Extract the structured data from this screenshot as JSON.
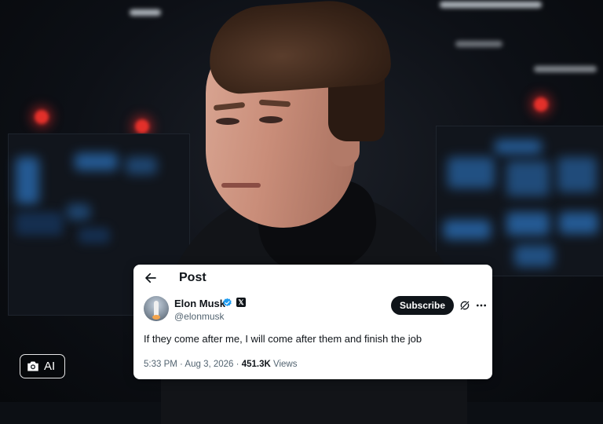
{
  "post_header": {
    "title": "Post"
  },
  "author": {
    "name": "Elon Musk",
    "handle": "@elonmusk"
  },
  "actions": {
    "subscribe_label": "Subscribe"
  },
  "tweet": {
    "text": "If they come after me, I will come after them and finish the job",
    "time": "5:33 PM",
    "separator": " · ",
    "date": "Aug 3, 2026",
    "views_count": "451.3K",
    "views_label": " Views"
  },
  "badge": {
    "label": "AI"
  },
  "icons": {
    "back": "arrow-left-icon",
    "verified": "verified-badge-icon",
    "affiliation": "x-logo-icon",
    "grok": "grok-icon",
    "more": "more-horizontal-icon",
    "camera": "camera-icon"
  },
  "colors": {
    "verified": "#1d9bf0",
    "text_primary": "#0f1419",
    "text_secondary": "#536471",
    "subscribe_bg": "#0f1419"
  }
}
